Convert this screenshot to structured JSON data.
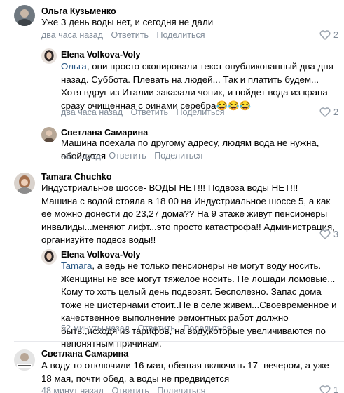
{
  "actions": {
    "reply": "Ответить",
    "share": "Поделиться"
  },
  "comments": [
    {
      "author": "Ольга Кузьменко",
      "text": "Уже 3 день воды нет, и сегодня не дали",
      "time": "два часа назад",
      "likes": "2",
      "avatar": "avatar"
    },
    {
      "author": "Elena Volkova-Voly",
      "mention": "Ольга",
      "text": ", они просто скопировали текст опубликованный два дня назад. Суббота. Плевать на людей... Так и платить будем... Хотя вдруг из Италии заказали чопик, и пойдет вода из крана сразу очищенная с оинами серебра😂😂😂",
      "time": "два часа назад",
      "likes": "2"
    },
    {
      "author": "Светлана Самарина",
      "text": "Машина поехала по другому адресу, людям вода не нужна, обойдутся",
      "time": "час назад"
    },
    {
      "author": "Tamara Chuchko",
      "text": "Индустриальное шоссе- ВОДЫ НЕТ!!! Подвоза воды НЕТ!!! Машина с водой стояла в 18 00 на Индустриальное шоссе 5, а как её можно донести до 23,27 дома?? На 9 этаже живут пенсионеры инвалиды...меняют лифт...это просто катастрофа!! Администрация, организуйте подвоз воды!!",
      "time": "",
      "likes": "3"
    },
    {
      "author": "Elena Volkova-Voly",
      "mention": "Tamara",
      "text": ", а ведь не только пенсионеры не могут воду носить. Женщины не все могут тяжелое носить. Не лошади ломовые... Кому то хоть целый день подвозят. Бесполезно. Запас дома тоже не цистернами стоит..Не в селе живем...Своевременное и качественное выполнение ремонтных работ должно быть.,исходя из тарифов, на воду,которые увеличиваются по непонятным причинам.",
      "time": "52 минуты назад"
    },
    {
      "author": "Светлана Самарина",
      "text": "А воду то отключили 16 мая, обещая включить 17- вечером, а уже 18 мая, почти обед, а воды не предвидется",
      "time": "48 минут назад",
      "likes": "1"
    }
  ]
}
